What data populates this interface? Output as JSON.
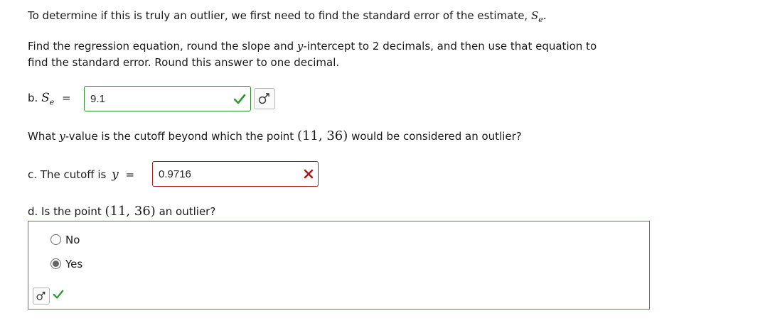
{
  "intro": {
    "line1_text": "To determine if this is truly an outlier, we first need to find the standard error of the estimate,",
    "line1_var": "S",
    "line1_sub": "e",
    "line1_end": ".",
    "instruction_line1": "Find the regression equation, round the slope and",
    "instruction_y": "y",
    "instruction_line1b": "-intercept to 2 decimals, and then use that equation to",
    "instruction_line2": "find the standard error. Round this answer to one decimal."
  },
  "part_b": {
    "prefix": "b.",
    "var": "S",
    "sub": "e",
    "equals": "=",
    "value": "9.1",
    "status": "correct"
  },
  "question_c": {
    "text_a": "What",
    "y": "y",
    "text_b": "-value is the cutoff beyond which the point",
    "point": "(11, 36)",
    "text_c": "would be considered an outlier?"
  },
  "part_c": {
    "prefix": "c. The cutoff is",
    "var": "y",
    "equals": "=",
    "value": "0.9716",
    "status": "incorrect"
  },
  "part_d": {
    "prefix": "d. Is the point",
    "point": "(11, 36)",
    "suffix": "an outlier?",
    "options": [
      "No",
      "Yes"
    ],
    "selected": "Yes",
    "status": "correct"
  },
  "colors": {
    "correct": "#2e9a2e",
    "incorrect": "#a61b1b"
  },
  "icons": [
    "checkmark-icon",
    "x-mark-icon",
    "keyboard-symbol-icon"
  ]
}
